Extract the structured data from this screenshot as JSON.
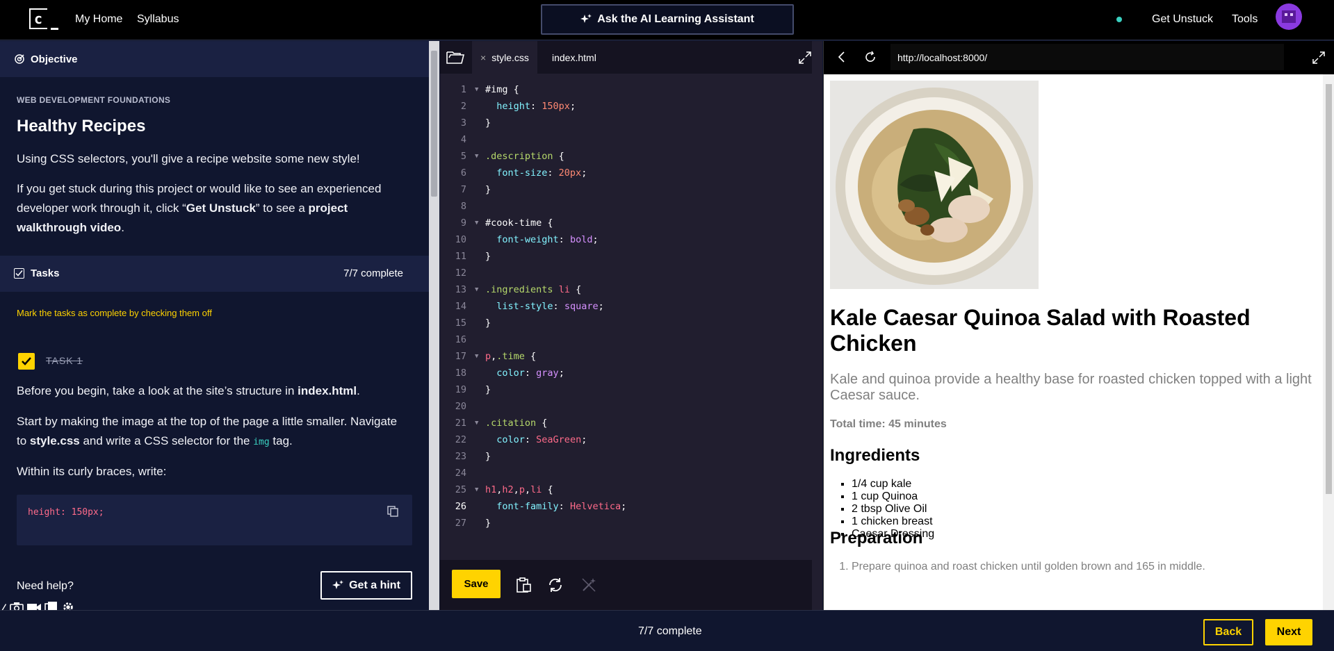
{
  "header": {
    "nav": [
      "My Home",
      "Syllabus"
    ],
    "ai_button": "Ask the AI Learning Assistant",
    "get_unstuck": "Get Unstuck",
    "tools": "Tools"
  },
  "lesson": {
    "objective_label": "Objective",
    "course": "WEB DEVELOPMENT FOUNDATIONS",
    "title": "Healthy Recipes",
    "intro": "Using CSS selectors, you'll give a recipe website some new style!",
    "stuck_pre": "If you get stuck during this project or would like to see an experienced developer work through it, click “",
    "stuck_bold1": "Get Unstuck",
    "stuck_mid": "” to see a ",
    "stuck_bold2": "project walkthrough video",
    "stuck_end": ".",
    "tasks_label": "Tasks",
    "tasks_count": "7/7 complete",
    "instructions": "Mark the tasks as complete by checking them off",
    "task1_label": "TASK 1",
    "task1_p1_pre": "Before you begin, take a look at the site’s structure in ",
    "task1_p1_bold": "index.html",
    "task1_p1_end": ".",
    "task1_p2_pre": "Start by making the image at the top of the page a little smaller. Navigate to ",
    "task1_p2_bold": "style.css",
    "task1_p2_mid": " and write a CSS selector for the ",
    "task1_p2_code": "img",
    "task1_p2_end": " tag.",
    "task1_p3": "Within its curly braces, write:",
    "code_snippet": "height: 150px;",
    "need_help": "Need help?",
    "hint_button": "Get a hint"
  },
  "editor": {
    "tabs": [
      "style.css",
      "index.html"
    ],
    "save_label": "Save",
    "current_line": 26,
    "lines": [
      [
        [
          "sel-id",
          "#img"
        ],
        [
          "",
          " {"
        ]
      ],
      [
        [
          "prop",
          "  height"
        ],
        [
          "",
          ": "
        ],
        [
          "val",
          "150px"
        ],
        [
          "",
          ";"
        ]
      ],
      [
        [
          "",
          "}"
        ]
      ],
      [],
      [
        [
          "sel-cls",
          ".description"
        ],
        [
          "",
          " {"
        ]
      ],
      [
        [
          "prop",
          "  font-size"
        ],
        [
          "",
          ": "
        ],
        [
          "val",
          "20px"
        ],
        [
          "",
          ";"
        ]
      ],
      [
        [
          "",
          "}"
        ]
      ],
      [],
      [
        [
          "sel-id",
          "#cook-time"
        ],
        [
          "",
          " {"
        ]
      ],
      [
        [
          "prop",
          "  font-weight"
        ],
        [
          "",
          ": "
        ],
        [
          "kw",
          "bold"
        ],
        [
          "",
          ";"
        ]
      ],
      [
        [
          "",
          "}"
        ]
      ],
      [],
      [
        [
          "sel-cls",
          ".ingredients"
        ],
        [
          "",
          " "
        ],
        [
          "tagc",
          "li"
        ],
        [
          "",
          " {"
        ]
      ],
      [
        [
          "prop",
          "  list-style"
        ],
        [
          "",
          ": "
        ],
        [
          "kw",
          "square"
        ],
        [
          "",
          ";"
        ]
      ],
      [
        [
          "",
          "}"
        ]
      ],
      [],
      [
        [
          "tagc",
          "p"
        ],
        [
          "",
          ","
        ],
        [
          "sel-cls",
          ".time"
        ],
        [
          "",
          " {"
        ]
      ],
      [
        [
          "prop",
          "  color"
        ],
        [
          "",
          ": "
        ],
        [
          "kw",
          "gray"
        ],
        [
          "",
          ";"
        ]
      ],
      [
        [
          "",
          "}"
        ]
      ],
      [],
      [
        [
          "sel-cls",
          ".citation"
        ],
        [
          "",
          " {"
        ]
      ],
      [
        [
          "prop",
          "  color"
        ],
        [
          "",
          ": "
        ],
        [
          "tagc",
          "SeaGreen"
        ],
        [
          "",
          ";"
        ]
      ],
      [
        [
          "",
          "}"
        ]
      ],
      [],
      [
        [
          "tagc",
          "h1"
        ],
        [
          "",
          ","
        ],
        [
          "tagc",
          "h2"
        ],
        [
          "",
          ","
        ],
        [
          "tagc",
          "p"
        ],
        [
          "",
          ","
        ],
        [
          "tagc",
          "li"
        ],
        [
          "",
          " {"
        ]
      ],
      [
        [
          "prop",
          "  font-family"
        ],
        [
          "",
          ": "
        ],
        [
          "tagc",
          "Helvetica"
        ],
        [
          "",
          ";"
        ]
      ],
      [
        [
          "",
          "}"
        ]
      ]
    ],
    "fold_lines": [
      1,
      5,
      9,
      13,
      17,
      21,
      25
    ]
  },
  "browser": {
    "url": "http://localhost:8000/",
    "recipe_title": "Kale Caesar Quinoa Salad with Roasted Chicken",
    "description": "Kale and quinoa provide a healthy base for roasted chicken topped with a light Caesar sauce.",
    "cook_time": "Total time: 45 minutes",
    "ingredients_heading": "Ingredients",
    "ingredients": [
      "1/4 cup kale",
      "1 cup Quinoa",
      "2 tbsp Olive Oil",
      "1 chicken breast",
      "Caesar Dressing"
    ],
    "preparation_heading": "Preparation",
    "preparation": [
      "Prepare quinoa and roast chicken until golden brown and 165 in middle."
    ]
  },
  "footer": {
    "count": "7/7 complete",
    "back": "Back",
    "next": "Next"
  },
  "colors": {
    "accent": "#ffd300",
    "panel": "#10162f",
    "editor": "#211e2f"
  }
}
